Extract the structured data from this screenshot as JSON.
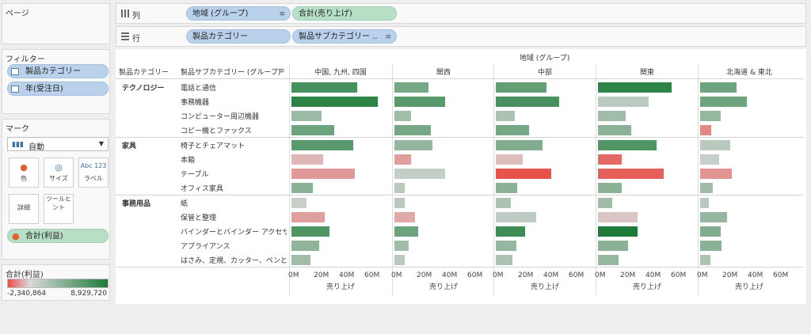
{
  "pages": {
    "title": "ページ"
  },
  "filters": {
    "title": "フィルター",
    "items": [
      {
        "label": "製品カテゴリー"
      },
      {
        "label": "年(受注日)"
      }
    ]
  },
  "marks": {
    "title": "マーク",
    "type": "自動",
    "buttons": [
      {
        "label": "色",
        "icon": "color-icon",
        "glyph": "●"
      },
      {
        "label": "サイズ",
        "icon": "size-icon",
        "glyph": "◎"
      },
      {
        "label": "ラベル",
        "icon": "label-icon",
        "glyph": "Abc 123"
      },
      {
        "label": "詳細",
        "icon": "detail-icon",
        "glyph": ""
      },
      {
        "label": "ツールヒント",
        "icon": "tooltip-icon",
        "glyph": ""
      }
    ],
    "color_field": "合計(利益)"
  },
  "legend": {
    "title": "合計(利益)",
    "min": "-2,340,864",
    "max": "8,929,720",
    "colors": {
      "negative": "#e8504a",
      "mid": "#d9d9d9",
      "positive": "#1e7b3a"
    }
  },
  "shelves": {
    "columns": {
      "label": "列",
      "pills": [
        {
          "label": "地域 (グループ)",
          "kind": "dimension",
          "sorted": true
        },
        {
          "label": "合計(売り上げ)",
          "kind": "measure",
          "sorted": false
        }
      ]
    },
    "rows": {
      "label": "行",
      "pills": [
        {
          "label": "製品カテゴリー",
          "kind": "dimension",
          "sorted": false
        },
        {
          "label": "製品サブカテゴリー ..",
          "kind": "dimension",
          "sorted": true
        }
      ]
    }
  },
  "view": {
    "top_header": "地域 (グループ)",
    "row_header_1": "製品カテゴリー",
    "row_header_2": "製品サブカテゴリー (グループ)",
    "axis_title": "売り上げ",
    "axis_ticks": [
      "0M",
      "20M",
      "40M",
      "60M"
    ]
  },
  "chart_data": {
    "type": "bar",
    "orientation": "horizontal",
    "regions": [
      "中国, 九州, 四国",
      "関西",
      "中部",
      "関東",
      "北海道 & 東北"
    ],
    "categories": [
      {
        "name": "テクノロジー",
        "subcategories": [
          "電話と通信",
          "事務機器",
          "コンピューター周辺機器",
          "コピー機とファックス"
        ]
      },
      {
        "name": "家具",
        "subcategories": [
          "椅子とチェアマット",
          "本箱",
          "テーブル",
          "オフィス家具"
        ]
      },
      {
        "name": "事務用品",
        "subcategories": [
          "紙",
          "保管と整理",
          "バインダーとバインダー アクセサリー",
          "アプライアンス",
          "はさみ、定規、カッター、ペンと画材 ..."
        ]
      }
    ],
    "xlabel": "売り上げ",
    "xlim": [
      0,
      75
    ],
    "unit": "M",
    "color_measure": "合計(利益)",
    "color_range": [
      -2340864,
      8929720
    ],
    "values": [
      [
        52,
        68,
        24,
        34,
        49,
        25,
        50,
        17,
        12,
        26,
        30,
        22,
        15
      ],
      [
        27,
        40,
        13,
        29,
        30,
        13,
        40,
        8,
        8,
        16,
        19,
        11,
        8
      ],
      [
        40,
        50,
        15,
        26,
        37,
        21,
        44,
        17,
        12,
        32,
        23,
        16,
        13
      ],
      [
        58,
        40,
        22,
        26,
        46,
        19,
        52,
        19,
        11,
        31,
        31,
        24,
        16
      ],
      [
        29,
        37,
        16,
        9,
        24,
        15,
        25,
        10,
        7,
        21,
        16,
        17,
        8
      ]
    ],
    "profit": [
      [
        6500000,
        8000000,
        2200000,
        4500000,
        5500000,
        -400000,
        -900000,
        3000000,
        500000,
        -800000,
        6000000,
        2800000,
        2000000
      ],
      [
        4000000,
        5500000,
        2000000,
        4000000,
        2500000,
        -800000,
        600000,
        1000000,
        1000000,
        -600000,
        4500000,
        2000000,
        1000000
      ],
      [
        5000000,
        6500000,
        1500000,
        4000000,
        3500000,
        -300000,
        -2300000,
        3000000,
        1500000,
        800000,
        7000000,
        2500000,
        1500000
      ],
      [
        8000000,
        900000,
        2000000,
        3000000,
        6000000,
        -1800000,
        -2000000,
        3000000,
        2000000,
        -200000,
        8900000,
        3000000,
        2500000
      ],
      [
        4500000,
        4500000,
        2500000,
        -1200000,
        1000000,
        500000,
        -1000000,
        2000000,
        1000000,
        2500000,
        3500000,
        3000000,
        1500000
      ]
    ]
  }
}
